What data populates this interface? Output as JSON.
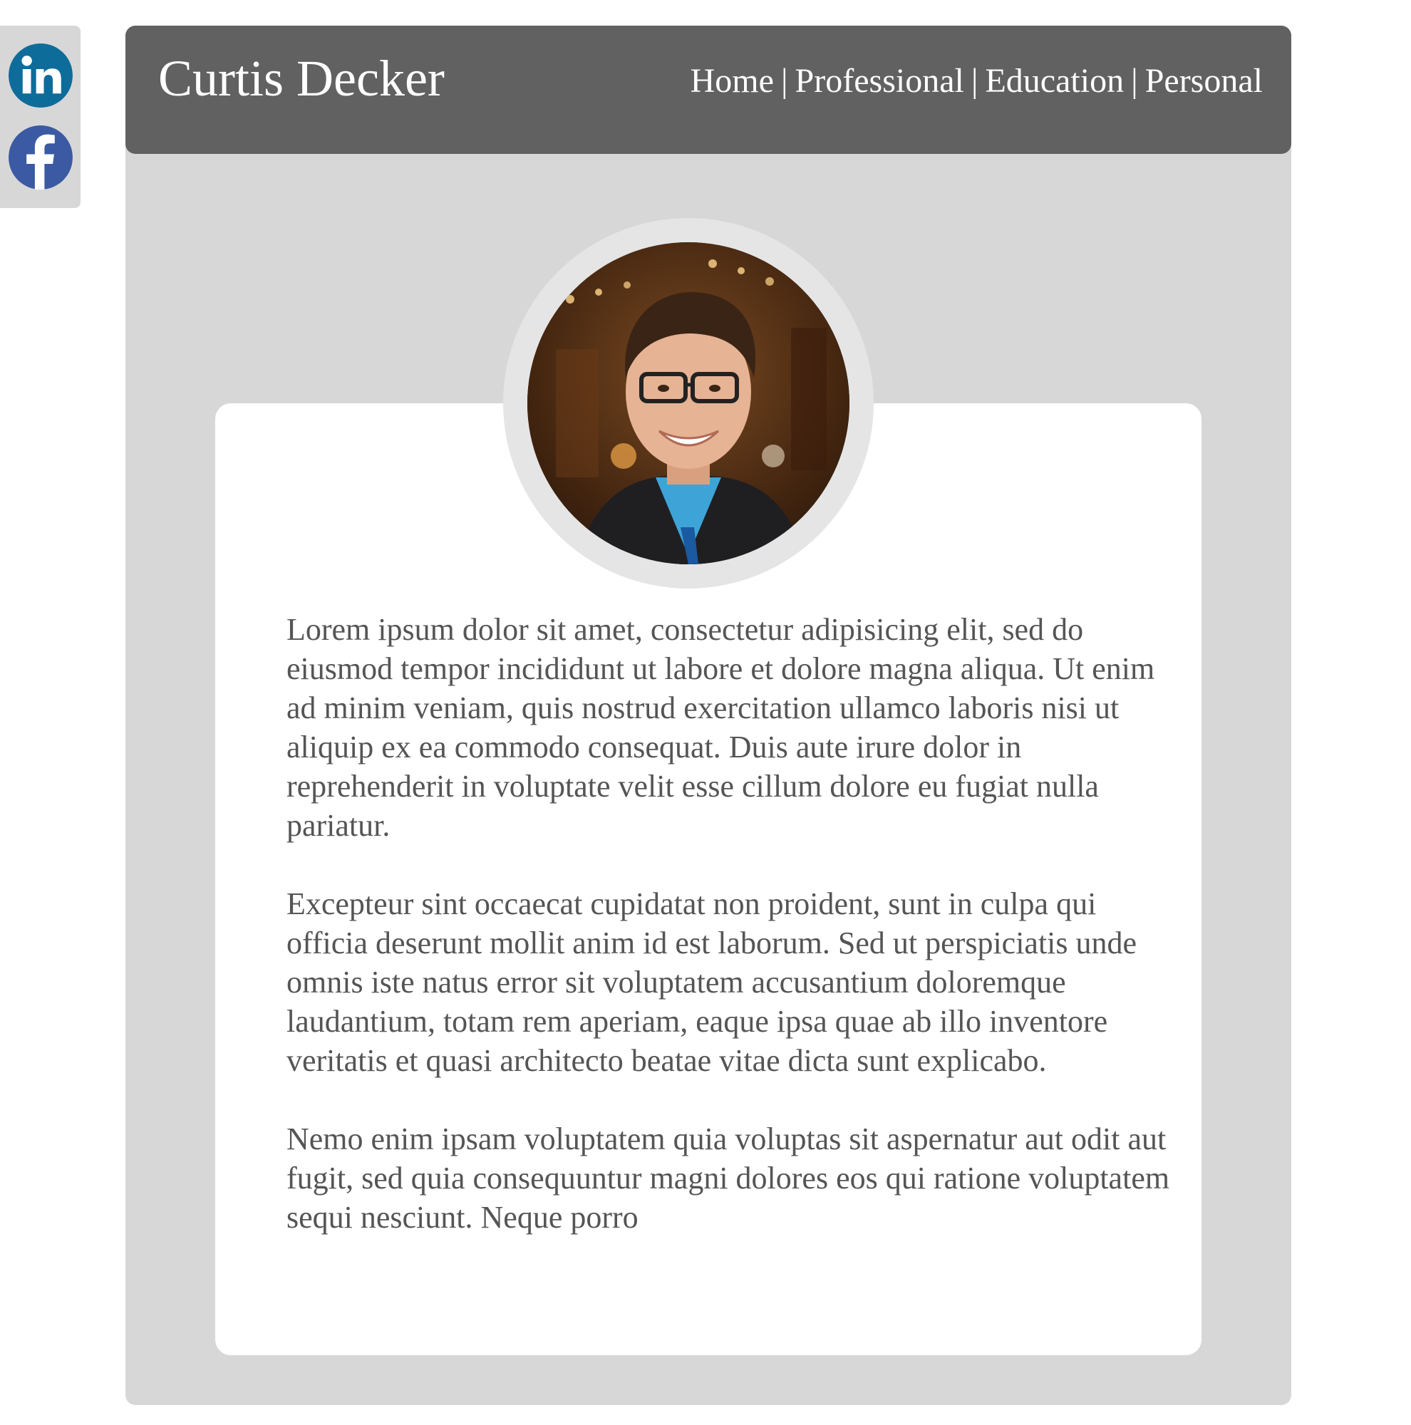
{
  "social": {
    "linkedin": {
      "icon": "linkedin-icon",
      "color": "#0e6c9b"
    },
    "facebook": {
      "icon": "facebook-icon",
      "color": "#3b5aa3"
    }
  },
  "header": {
    "title": "Curtis Decker",
    "nav": [
      {
        "label": "Home"
      },
      {
        "label": "Professional"
      },
      {
        "label": "Education"
      },
      {
        "label": "Personal"
      }
    ],
    "separator": "|"
  },
  "profile": {
    "photo_icon": "profile-photo"
  },
  "bio": {
    "paragraphs": [
      "Lorem ipsum dolor sit amet, consectetur adipisicing elit, sed do eiusmod tempor incididunt ut labore et dolore magna aliqua. Ut enim ad minim veniam, quis nostrud exercitation ullamco laboris nisi ut aliquip ex ea commodo consequat. Duis aute irure dolor in reprehenderit in voluptate velit esse cillum dolore eu fugiat nulla pariatur.",
      "Excepteur sint occaecat cupidatat non proident, sunt in culpa qui officia deserunt mollit anim id est laborum. Sed ut perspiciatis unde omnis iste natus error sit voluptatem accusantium doloremque laudantium, totam rem aperiam, eaque ipsa quae ab illo inventore veritatis et quasi architecto beatae vitae dicta sunt explicabo.",
      "Nemo enim ipsam voluptatem quia voluptas sit aspernatur aut odit aut fugit, sed quia consequuntur magni dolores eos qui ratione voluptatem sequi nesciunt. Neque porro"
    ]
  },
  "colors": {
    "header_bg": "#616161",
    "panel_bg": "#d7d7d7",
    "text": "#555555"
  }
}
